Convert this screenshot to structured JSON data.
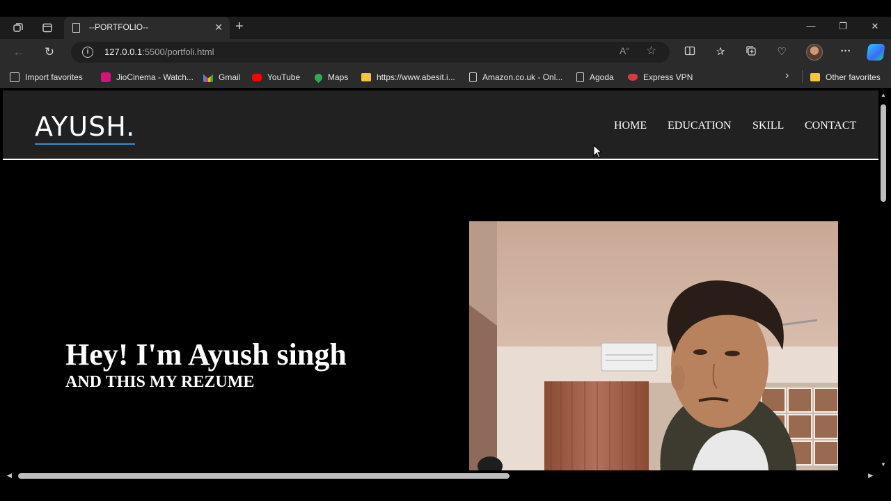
{
  "browser": {
    "tab": {
      "title": "--PORTFOLIO--"
    },
    "address": {
      "host": "127.0.0.1",
      "path": ":5500/portfoli.html"
    },
    "bookmarks": [
      {
        "label": "Import favorites",
        "icon": "import-icon"
      },
      {
        "label": "JioCinema - Watch...",
        "icon": "jiocinema-icon"
      },
      {
        "label": "Gmail",
        "icon": "gmail-icon"
      },
      {
        "label": "YouTube",
        "icon": "youtube-icon"
      },
      {
        "label": "Maps",
        "icon": "maps-icon"
      },
      {
        "label": "https://www.abesit.i...",
        "icon": "folder-icon"
      },
      {
        "label": "Amazon.co.uk - Onl...",
        "icon": "page-icon"
      },
      {
        "label": "Agoda",
        "icon": "page-icon"
      },
      {
        "label": "Express VPN",
        "icon": "vpn-icon"
      }
    ],
    "other_favorites": "Other favorites"
  },
  "site": {
    "logo": "AYUSH.",
    "nav": [
      "HOME",
      "EDUCATION",
      "SKILL",
      "CONTACT"
    ],
    "hero_title": "Hey! I'm Ayush singh",
    "hero_subtitle": "AND THIS MY REZUME"
  },
  "colors": {
    "page_bg": "#000000",
    "header_bg": "#212121",
    "logo_underline": "#2f8fd8",
    "text": "#ffffff"
  }
}
